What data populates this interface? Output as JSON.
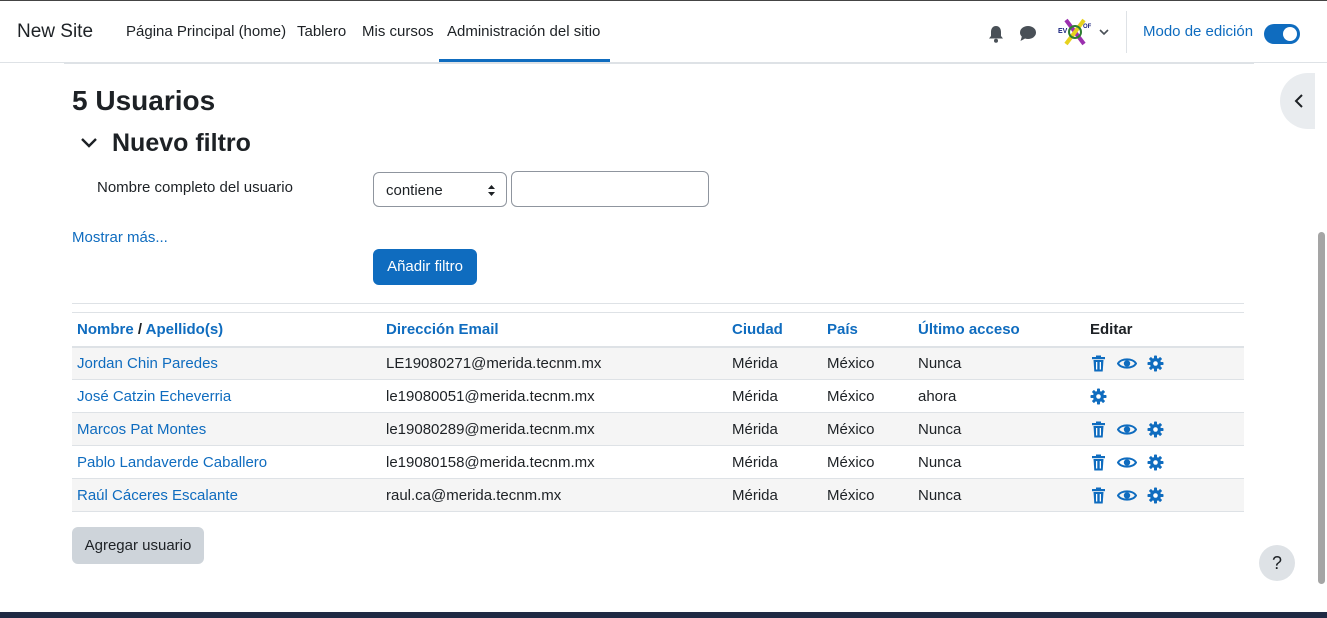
{
  "navbar": {
    "brand": "New Site",
    "links": [
      {
        "label": "Página Principal (home)"
      },
      {
        "label": "Tablero"
      },
      {
        "label": "Mis cursos"
      },
      {
        "label": "Administración del sitio",
        "active": true
      }
    ],
    "icons": [
      "bell-icon",
      "chat-icon"
    ],
    "edit_mode_label": "Modo de edición",
    "edit_mode_on": true,
    "accent": "#0f6cbf"
  },
  "page": {
    "title": "5 Usuarios",
    "filter_title": "Nuevo filtro",
    "filter_field_label": "Nombre completo del usuario",
    "filter_operator": "contiene",
    "filter_value": "",
    "show_more": "Mostrar más...",
    "add_filter_button": "Añadir filtro",
    "add_user_button": "Agregar usuario",
    "help_label": "?"
  },
  "table": {
    "headers": {
      "first_name": "Nombre",
      "separator": "/",
      "last_name": "Apellido(s)",
      "email": "Dirección Email",
      "city": "Ciudad",
      "country": "País",
      "last_access": "Último acceso",
      "edit": "Editar"
    },
    "rows": [
      {
        "name": "Jordan Chin Paredes",
        "email": "LE19080271@merida.tecnm.mx",
        "city": "Mérida",
        "country": "México",
        "last_access": "Nunca",
        "actions": [
          "trash-icon",
          "eye-icon",
          "gear-icon"
        ]
      },
      {
        "name": "José Catzin Echeverria",
        "email": "le19080051@merida.tecnm.mx",
        "city": "Mérida",
        "country": "México",
        "last_access": "ahora",
        "actions": [
          "gear-icon"
        ]
      },
      {
        "name": "Marcos Pat Montes",
        "email": "le19080289@merida.tecnm.mx",
        "city": "Mérida",
        "country": "México",
        "last_access": "Nunca",
        "actions": [
          "trash-icon",
          "eye-icon",
          "gear-icon"
        ]
      },
      {
        "name": "Pablo Landaverde Caballero",
        "email": "le19080158@merida.tecnm.mx",
        "city": "Mérida",
        "country": "México",
        "last_access": "Nunca",
        "actions": [
          "trash-icon",
          "eye-icon",
          "gear-icon"
        ]
      },
      {
        "name": "Raúl Cáceres Escalante",
        "email": "raul.ca@merida.tecnm.mx",
        "city": "Mérida",
        "country": "México",
        "last_access": "Nunca",
        "actions": [
          "trash-icon",
          "eye-icon",
          "gear-icon"
        ]
      }
    ]
  }
}
